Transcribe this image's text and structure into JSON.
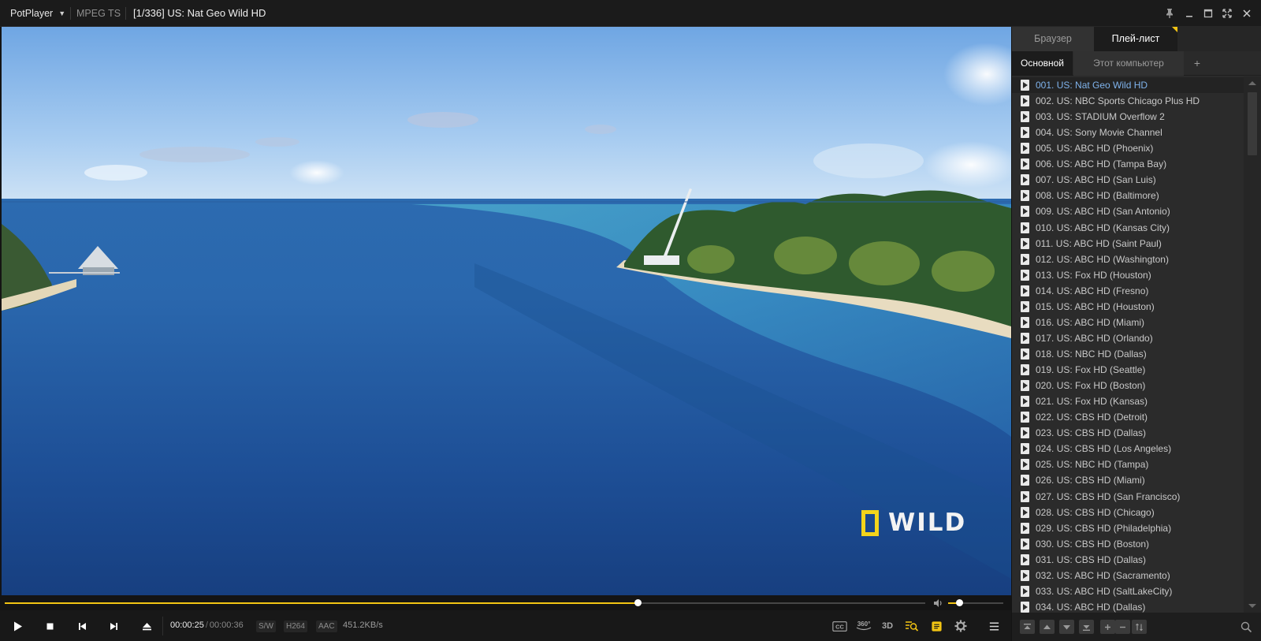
{
  "titlebar": {
    "app_name": "PotPlayer",
    "format": "MPEG TS",
    "media_title": "[1/336] US: Nat Geo Wild HD",
    "window_buttons": [
      "pin-icon",
      "minimize-icon",
      "maximize-icon",
      "fullscreen-icon",
      "close-icon"
    ]
  },
  "video": {
    "watermark_text": "WILD",
    "watermark_color": "#f4d41b"
  },
  "seekbar": {
    "progress": 0.6877,
    "volume": 0.2,
    "accent_color": "#f2c413"
  },
  "controls": {
    "buttons": [
      "play-icon",
      "stop-icon",
      "previous-icon",
      "next-icon",
      "eject-icon"
    ],
    "current_time": "00:00:25",
    "separator": "/",
    "total_time": "00:00:36",
    "tags": [
      "S/W",
      "H264",
      "AAC"
    ],
    "bitrate": "451.2KB/s",
    "right_buttons": {
      "cc": "CC",
      "vr": "360°",
      "threed": "3D"
    },
    "right_icons": [
      "subtitle-icon",
      "360-icon",
      "3d-icon",
      "zoom-list-icon",
      "note-icon",
      "gear-icon",
      "menu-icon"
    ]
  },
  "panel": {
    "tabs": [
      "Браузер",
      "Плей-лист"
    ],
    "active_tab": "Плей-лист",
    "subtabs": [
      "Основной",
      "Этот компьютер",
      "+"
    ],
    "active_subtab": "Основной",
    "current_index": 0,
    "current_color": "#7fb3ec",
    "items": [
      "001. US: Nat Geo Wild HD",
      "002. US: NBC Sports Chicago Plus HD",
      "003. US: STADIUM Overflow 2",
      "004. US: Sony Movie Channel",
      "005. US: ABC HD (Phoenix)",
      "006. US: ABC HD (Tampa Bay)",
      "007. US: ABC HD (San Luis)",
      "008. US: ABC HD (Baltimore)",
      "009. US: ABC HD (San Antonio)",
      "010. US: ABC HD (Kansas City)",
      "011. US: ABC HD (Saint Paul)",
      "012. US: ABC HD (Washington)",
      "013. US: Fox HD (Houston)",
      "014. US: ABC HD (Fresno)",
      "015. US: ABC HD (Houston)",
      "016. US: ABC HD (Miami)",
      "017. US: ABC HD (Orlando)",
      "018. US: NBC HD (Dallas)",
      "019. US: Fox HD (Seattle)",
      "020. US: Fox HD (Boston)",
      "021. US: Fox HD (Kansas)",
      "022. US: CBS HD (Detroit)",
      "023. US: CBS HD (Dallas)",
      "024. US: CBS HD (Los Angeles)",
      "025. US: NBC HD (Tampa)",
      "026. US: CBS HD (Miami)",
      "027. US: CBS HD (San Francisco)",
      "028. US: CBS HD (Chicago)",
      "029. US: CBS HD (Philadelphia)",
      "030. US: CBS HD (Boston)",
      "031. US: CBS HD (Dallas)",
      "032. US: ABC HD (Sacramento)",
      "033. US: ABC HD (SaltLakeCity)",
      "034. US: ABC HD (Dallas)"
    ],
    "footer_icons": [
      "move-top-icon",
      "move-up-icon",
      "move-down-icon",
      "move-bottom-icon",
      "add-icon",
      "remove-icon",
      "sort-icon",
      "search-icon"
    ]
  }
}
